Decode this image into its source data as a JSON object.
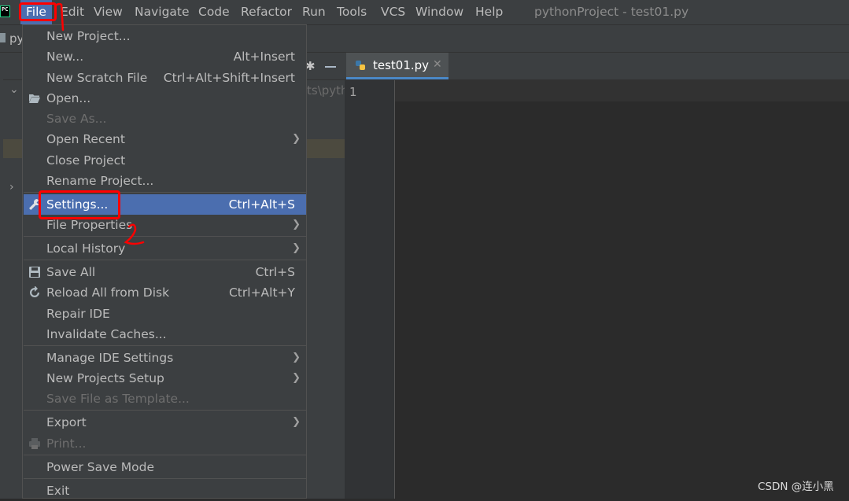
{
  "menubar": {
    "logo_text": "PC",
    "items": [
      {
        "label": "File"
      },
      {
        "label": "Edit"
      },
      {
        "label": "View"
      },
      {
        "label": "Navigate"
      },
      {
        "label": "Code"
      },
      {
        "label": "Refactor"
      },
      {
        "label": "Run"
      },
      {
        "label": "Tools"
      },
      {
        "label": "VCS"
      },
      {
        "label": "Window"
      },
      {
        "label": "Help"
      }
    ],
    "window_title": "pythonProject - test01.py"
  },
  "navbar": {
    "project_label": "py"
  },
  "project_pane": {
    "path_fragment": "ts\\pyth"
  },
  "editor": {
    "tab_label": "test01.py",
    "line_number": "1"
  },
  "file_menu": {
    "items": [
      {
        "label": "New Project...",
        "shortcut": ""
      },
      {
        "label": "New...",
        "shortcut": "Alt+Insert"
      },
      {
        "label": "New Scratch File",
        "shortcut": "Ctrl+Alt+Shift+Insert"
      },
      {
        "label": "Open...",
        "shortcut": ""
      },
      {
        "label": "Save As...",
        "shortcut": ""
      },
      {
        "label": "Open Recent",
        "shortcut": ""
      },
      {
        "label": "Close Project",
        "shortcut": ""
      },
      {
        "label": "Rename Project...",
        "shortcut": ""
      },
      {
        "label": "Settings...",
        "shortcut": "Ctrl+Alt+S"
      },
      {
        "label": "File Properties",
        "shortcut": ""
      },
      {
        "label": "Local History",
        "shortcut": ""
      },
      {
        "label": "Save All",
        "shortcut": "Ctrl+S"
      },
      {
        "label": "Reload All from Disk",
        "shortcut": "Ctrl+Alt+Y"
      },
      {
        "label": "Repair IDE",
        "shortcut": ""
      },
      {
        "label": "Invalidate Caches...",
        "shortcut": ""
      },
      {
        "label": "Manage IDE Settings",
        "shortcut": ""
      },
      {
        "label": "New Projects Setup",
        "shortcut": ""
      },
      {
        "label": "Save File as Template...",
        "shortcut": ""
      },
      {
        "label": "Export",
        "shortcut": ""
      },
      {
        "label": "Print...",
        "shortcut": ""
      },
      {
        "label": "Power Save Mode",
        "shortcut": ""
      },
      {
        "label": "Exit",
        "shortcut": ""
      }
    ]
  },
  "annotations": {
    "mark_1": "1",
    "mark_2": "2"
  },
  "watermark": "CSDN @连小黑",
  "colors": {
    "accent": "#4b6eaf",
    "annotation": "#ff0000",
    "menu_bg": "#3c3f41",
    "editor_bg": "#2b2b2b"
  }
}
